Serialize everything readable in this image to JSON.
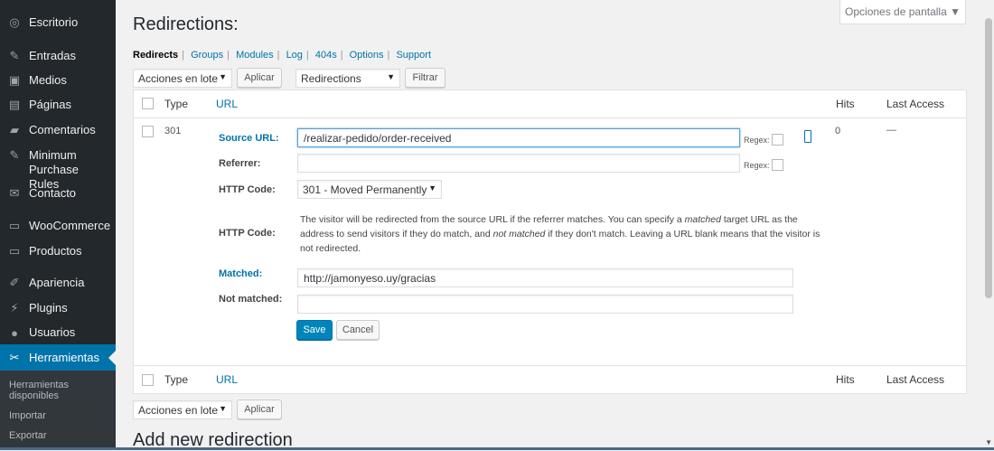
{
  "sidebar": {
    "items": [
      {
        "label": "Escritorio",
        "icon": "dashboard-icon",
        "glyph": "◎"
      },
      {
        "label": "Entradas",
        "icon": "pin-icon",
        "glyph": "✎"
      },
      {
        "label": "Medios",
        "icon": "media-icon",
        "glyph": "▣"
      },
      {
        "label": "Páginas",
        "icon": "pages-icon",
        "glyph": "▤"
      },
      {
        "label": "Comentarios",
        "icon": "comments-icon",
        "glyph": "▰"
      },
      {
        "label": "Minimum Purchase Rules",
        "icon": "pin-icon",
        "glyph": "✎"
      },
      {
        "label": "Contacto",
        "icon": "mail-icon",
        "glyph": "✉"
      },
      {
        "label": "WooCommerce",
        "icon": "woocommerce-icon",
        "glyph": "▭"
      },
      {
        "label": "Productos",
        "icon": "products-icon",
        "glyph": "▭"
      },
      {
        "label": "Apariencia",
        "icon": "appearance-icon",
        "glyph": "✐"
      },
      {
        "label": "Plugins",
        "icon": "plugins-icon",
        "glyph": "⚡"
      },
      {
        "label": "Usuarios",
        "icon": "users-icon",
        "glyph": "●"
      },
      {
        "label": "Herramientas",
        "icon": "tools-icon",
        "glyph": "✂"
      }
    ],
    "submenu": [
      "Herramientas disponibles",
      "Importar",
      "Exportar"
    ]
  },
  "screen_options": "Opciones de pantalla ▼",
  "page_title": "Redirections:",
  "nav": [
    "Redirects",
    "Groups",
    "Modules",
    "Log",
    "404s",
    "Options",
    "Support"
  ],
  "bulk": {
    "label": "Acciones en lote",
    "apply": "Aplicar"
  },
  "group_filter": {
    "label": "Redirections",
    "button": "Filtrar"
  },
  "columns": {
    "type": "Type",
    "url": "URL",
    "hits": "Hits",
    "last_access": "Last Access"
  },
  "row": {
    "type": "301",
    "hits": "0",
    "last_access": "—"
  },
  "form": {
    "source_label": "Source URL:",
    "source_value": "/realizar-pedido/order-received",
    "referrer_label": "Referrer:",
    "referrer_value": "",
    "regex_label": "Regex:",
    "http_code_label": "HTTP Code:",
    "http_code_value": "301 - Moved Permanently",
    "http_code_label2": "HTTP Code:",
    "matched_label": "Matched:",
    "matched_value": "http://jamonyeso.uy/gracias",
    "not_matched_label": "Not matched:",
    "not_matched_value": "",
    "save": "Save",
    "cancel": "Cancel"
  },
  "description": {
    "part1": "The visitor will be redirected from the source URL if the referrer matches. You can specify a ",
    "em1": "matched",
    "part2": " target URL as the address to send visitors if they do match, and ",
    "em2": "not matched",
    "part3": " if they don't match. Leaving a URL blank means that the visitor is not redirected."
  },
  "add_title": "Add new redirection",
  "colors": {
    "sidebar_bg": "#23282d",
    "active": "#0073aa",
    "link": "#0073aa",
    "primary": "#0085ba"
  }
}
